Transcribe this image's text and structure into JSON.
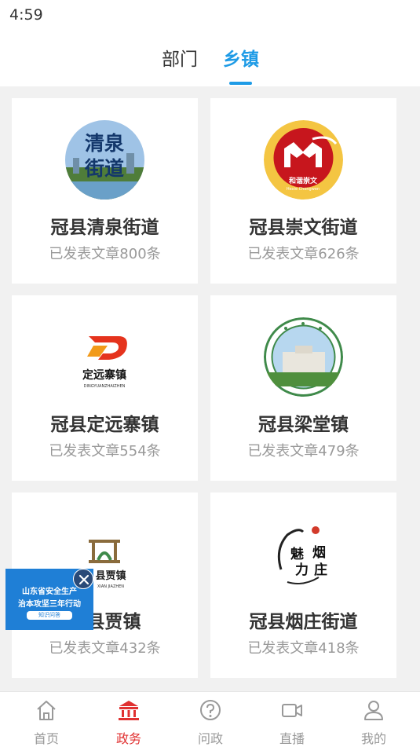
{
  "status_bar": {
    "time": "4:59"
  },
  "tabs": [
    {
      "label": "部门",
      "active": false
    },
    {
      "label": "乡镇",
      "active": true
    }
  ],
  "cards": [
    {
      "title": "冠县清泉街道",
      "count_text": "已发表文章800条",
      "logo_text": "清泉街道"
    },
    {
      "title": "冠县崇文街道",
      "count_text": "已发表文章626条",
      "logo_text": "和谐崇文",
      "logo_subtext": "Hexie Chongwen"
    },
    {
      "title": "冠县定远寨镇",
      "count_text": "已发表文章554条",
      "logo_text": "定远寨镇",
      "logo_subtext": "DINGYUANZHAIZHEN"
    },
    {
      "title": "冠县梁堂镇",
      "count_text": "已发表文章479条"
    },
    {
      "title": "冠县贾镇",
      "count_text": "已发表文章432条",
      "logo_text": "县贾镇",
      "logo_subtext": "XIAN JIAZHEN"
    },
    {
      "title": "冠县烟庄街道",
      "count_text": "已发表文章418条",
      "logo_text": "魅力烟庄"
    }
  ],
  "float_banner": {
    "line1": "山东省安全生产",
    "line2": "治本攻坚三年行动",
    "button": "知识问答"
  },
  "bottom_nav": [
    {
      "label": "首页",
      "icon": "home-icon",
      "active": false
    },
    {
      "label": "政务",
      "icon": "government-icon",
      "active": true
    },
    {
      "label": "问政",
      "icon": "question-icon",
      "active": false
    },
    {
      "label": "直播",
      "icon": "video-camera-icon",
      "active": false
    },
    {
      "label": "我的",
      "icon": "user-icon",
      "active": false
    }
  ],
  "colors": {
    "accent_blue": "#1e9be6",
    "active_red": "#e03131",
    "muted_gray": "#999999"
  }
}
